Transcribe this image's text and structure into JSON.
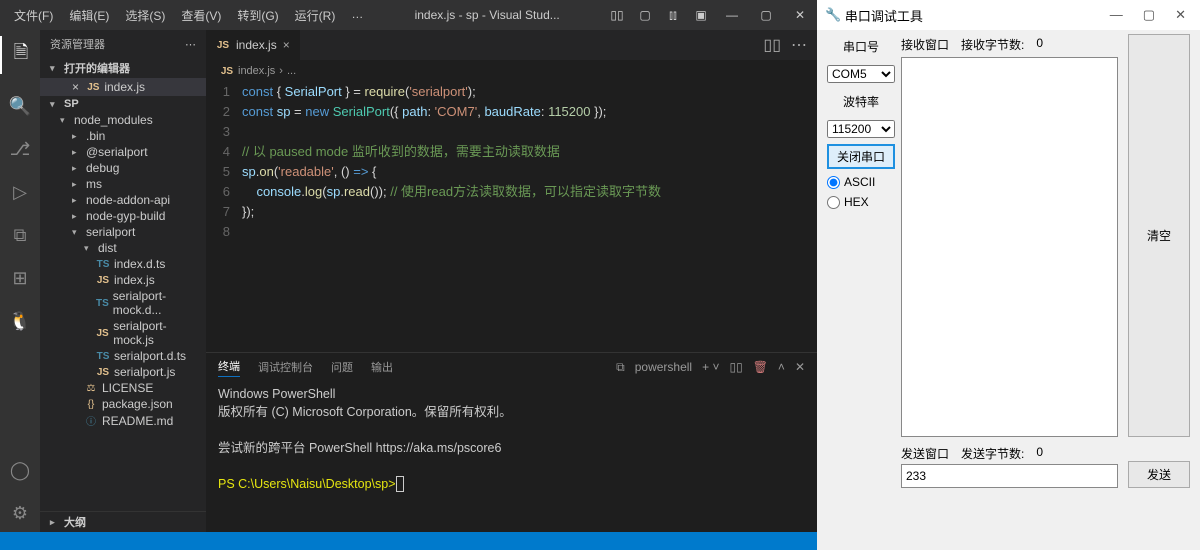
{
  "vscode": {
    "menus": [
      "文件(F)",
      "编辑(E)",
      "选择(S)",
      "查看(V)",
      "转到(G)",
      "运行(R)",
      "…"
    ],
    "title": "index.js - sp - Visual Stud...",
    "sidebar_title": "资源管理器",
    "open_editors": "打开的编辑器",
    "open_file": "index.js",
    "project": "SP",
    "tree": {
      "node_modules": "node_modules",
      "bin": ".bin",
      "atserialport": "@serialport",
      "debug": "debug",
      "ms": "ms",
      "node_addon": "node-addon-api",
      "node_gyp": "node-gyp-build",
      "serialport": "serialport",
      "dist": "dist",
      "index_dts": "index.d.ts",
      "index_js": "index.js",
      "sp_mock_d": "serialport-mock.d...",
      "sp_mock_js": "serialport-mock.js",
      "sp_dts": "serialport.d.ts",
      "sp_js": "serialport.js",
      "license": "LICENSE",
      "pkg": "package.json",
      "readme": "README.md",
      "outline": "大纲"
    },
    "tab_name": "index.js",
    "breadcrumb_file": "index.js",
    "breadcrumb_more": "...",
    "code": {
      "l1": "const { SerialPort } = require('serialport');",
      "l2": "const sp = new SerialPort({ path: 'COM7', baudRate: 115200 });",
      "l4c": "// 以 paused mode 监听收到的数据，需要主动读取数据",
      "l5a": "sp.on('readable', () => {",
      "l6a": "    console.log(sp.read()); ",
      "l6c": "// 使用read方法读取数据，可以指定读取字节数",
      "l7": "});"
    },
    "panel_tabs": [
      "终端",
      "调试控制台",
      "问题",
      "输出"
    ],
    "panel_shell": "powershell",
    "terminal": {
      "t1": "Windows PowerShell",
      "t2": "版权所有 (C) Microsoft Corporation。保留所有权利。",
      "t3": "尝试新的跨平台 PowerShell https://aka.ms/pscore6",
      "t4": "PS C:\\Users\\Naisu\\Desktop\\sp> "
    }
  },
  "serial": {
    "title": "串口调试工具",
    "port_label": "串口号",
    "port_value": "COM5",
    "baud_label": "波特率",
    "baud_value": "115200",
    "close_port": "关闭串口",
    "ascii": "ASCII",
    "hex": "HEX",
    "recv_win": "接收窗口",
    "recv_bytes_lbl": "接收字节数:",
    "recv_bytes": "0",
    "clear": "清空",
    "send_win": "发送窗口",
    "send_bytes_lbl": "发送字节数:",
    "send_bytes": "0",
    "send_value": "233",
    "send_btn": "发送"
  }
}
